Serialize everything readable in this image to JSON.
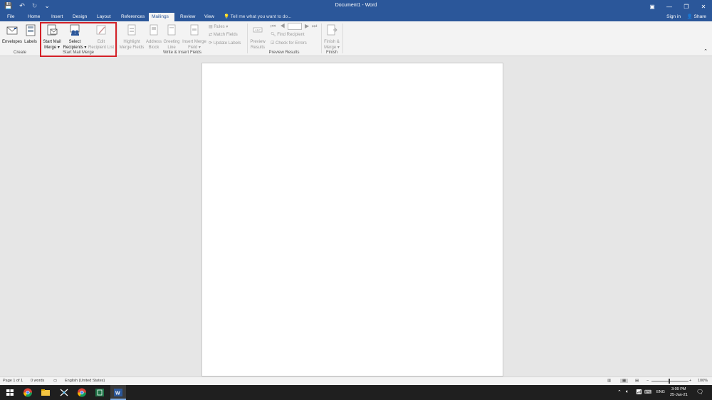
{
  "titlebar": {
    "title": "Document1 - Word",
    "qat_save": "💾",
    "qat_undo": "↶",
    "qat_redo": "↻",
    "qat_more": "⌄",
    "btn_ribbon": "▣",
    "btn_min": "—",
    "btn_max": "❐",
    "btn_close": "✕"
  },
  "tabs": [
    "File",
    "Home",
    "Insert",
    "Design",
    "Layout",
    "References",
    "Mailings",
    "Review",
    "View"
  ],
  "tellme": "Tell me what you want to do...",
  "signin": "Sign in",
  "share": "Share",
  "ribbon": {
    "create": {
      "envelopes": "Envelopes",
      "labels": "Labels",
      "group": "Create"
    },
    "start": {
      "start_mail_merge_1": "Start Mail",
      "start_mail_merge_2": "Merge ▾",
      "select_recipients_1": "Select",
      "select_recipients_2": "Recipients ▾",
      "edit_list_1": "Edit",
      "edit_list_2": "Recipient List",
      "group": "Start Mail Merge"
    },
    "write": {
      "highlight_1": "Highlight",
      "highlight_2": "Merge Fields",
      "address_1": "Address",
      "address_2": "Block",
      "greeting_1": "Greeting",
      "greeting_2": "Line",
      "insert_field_1": "Insert Merge",
      "insert_field_2": "Field ▾",
      "rules": "Rules ▾",
      "match_fields": "Match Fields",
      "update_labels": "Update Labels",
      "group": "Write & Insert Fields"
    },
    "preview": {
      "preview_1": "Preview",
      "preview_2": "Results",
      "find_recipient": "Find Recipient",
      "check_errors": "Check for Errors",
      "group": "Preview Results"
    },
    "finish": {
      "finish_1": "Finish &",
      "finish_2": "Merge ▾",
      "group": "Finish"
    }
  },
  "status": {
    "page": "Page 1 of 1",
    "words": "0 words",
    "language": "English (United States)",
    "zoom": "100%"
  },
  "taskbar": {
    "lang": "ENG",
    "time": "3:09 PM",
    "date": "25-Jan-21"
  },
  "colors": {
    "word_blue": "#2b579a",
    "highlight_red": "#d42128"
  }
}
